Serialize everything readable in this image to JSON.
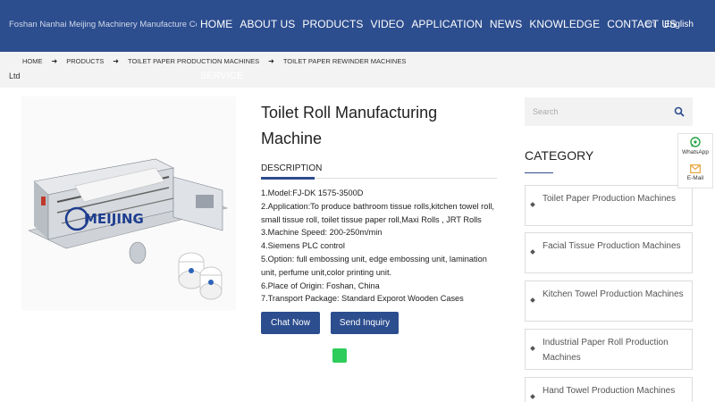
{
  "header": {
    "brand": "Foshan Nanhai Meijing Machinery Manufacture Co.,",
    "nav": [
      "HOME",
      "ABOUT US",
      "PRODUCTS",
      "VIDEO",
      "APPLICATION",
      "NEWS",
      "KNOWLEDGE",
      "CONTACT US"
    ],
    "lang_code": "en",
    "lang_label": "English"
  },
  "breadcrumb": [
    "HOME",
    "PRODUCTS",
    "TOILET PAPER PRODUCTION MACHINES",
    "TOILET PAPER REWINDER MACHINES"
  ],
  "overflow": {
    "ltd": "Ltd",
    "service": "SERVICE"
  },
  "product": {
    "title": "Toilet Roll Manufacturing Machine",
    "tab_label": "DESCRIPTION",
    "description": [
      "1.Model:FJ-DK 1575-3500D",
      "2.Application:To produce bathroom tissue rolls,kitchen towel roll, small tissue roll, toilet tissue paper roll,Maxi Rolls , JRT Rolls",
      "3.Machine Speed: 200-250m/min",
      "4.Siemens PLC control",
      "5.Option: full embossing unit, edge embossing unit, lamination unit, perfume unit,color printing unit.",
      "6.Place of Origin: Foshan, China",
      "7.Transport Package: Standard Exporot Wooden Cases"
    ],
    "chat_label": "Chat Now",
    "inquiry_label": "Send Inquiry",
    "image_logo_text": "MEIJING"
  },
  "sidebar": {
    "search_placeholder": "Search",
    "category_title": "CATEGORY",
    "categories": [
      "Toilet Paper Production Machines",
      "Facial Tissue Production Machines",
      "Kitchen Towel Production Machines",
      "Industrial Paper Roll Production Machines",
      "Hand Towel Production Machines"
    ]
  },
  "floating": {
    "whatsapp": "WhatsApp",
    "email": "E-Mail"
  },
  "colors": {
    "brand_blue": "#2c4d8e",
    "green": "#2ecc5a",
    "whatsapp_green": "#25a244",
    "mail_orange": "#e8a33d"
  },
  "icons": [
    "chevron-right-icon",
    "search-icon",
    "whatsapp-icon",
    "mail-icon"
  ]
}
